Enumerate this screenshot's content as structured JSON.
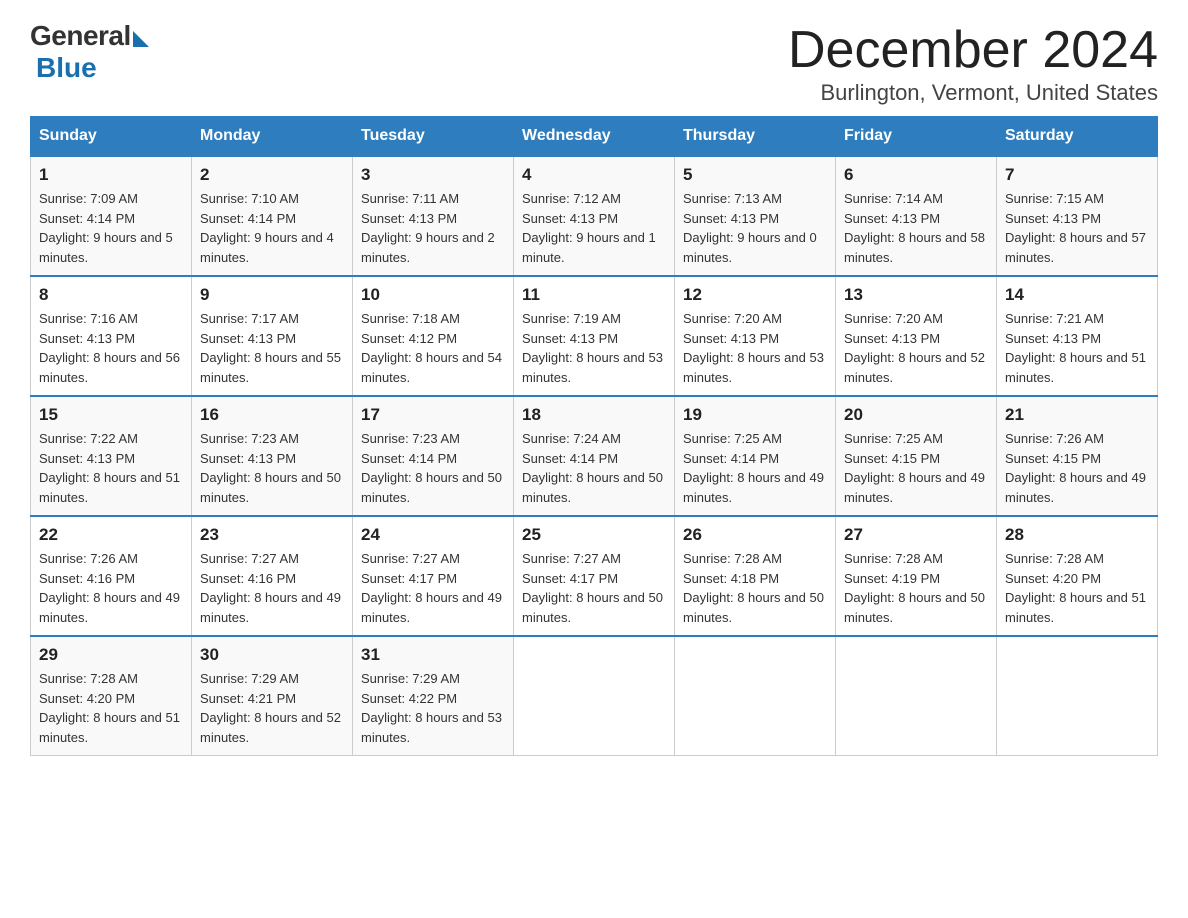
{
  "header": {
    "logo_general": "General",
    "logo_blue": "Blue",
    "title": "December 2024",
    "subtitle": "Burlington, Vermont, United States"
  },
  "days_of_week": [
    "Sunday",
    "Monday",
    "Tuesday",
    "Wednesday",
    "Thursday",
    "Friday",
    "Saturday"
  ],
  "weeks": [
    [
      {
        "day": "1",
        "sunrise": "7:09 AM",
        "sunset": "4:14 PM",
        "daylight": "9 hours and 5 minutes."
      },
      {
        "day": "2",
        "sunrise": "7:10 AM",
        "sunset": "4:14 PM",
        "daylight": "9 hours and 4 minutes."
      },
      {
        "day": "3",
        "sunrise": "7:11 AM",
        "sunset": "4:13 PM",
        "daylight": "9 hours and 2 minutes."
      },
      {
        "day": "4",
        "sunrise": "7:12 AM",
        "sunset": "4:13 PM",
        "daylight": "9 hours and 1 minute."
      },
      {
        "day": "5",
        "sunrise": "7:13 AM",
        "sunset": "4:13 PM",
        "daylight": "9 hours and 0 minutes."
      },
      {
        "day": "6",
        "sunrise": "7:14 AM",
        "sunset": "4:13 PM",
        "daylight": "8 hours and 58 minutes."
      },
      {
        "day": "7",
        "sunrise": "7:15 AM",
        "sunset": "4:13 PM",
        "daylight": "8 hours and 57 minutes."
      }
    ],
    [
      {
        "day": "8",
        "sunrise": "7:16 AM",
        "sunset": "4:13 PM",
        "daylight": "8 hours and 56 minutes."
      },
      {
        "day": "9",
        "sunrise": "7:17 AM",
        "sunset": "4:13 PM",
        "daylight": "8 hours and 55 minutes."
      },
      {
        "day": "10",
        "sunrise": "7:18 AM",
        "sunset": "4:12 PM",
        "daylight": "8 hours and 54 minutes."
      },
      {
        "day": "11",
        "sunrise": "7:19 AM",
        "sunset": "4:13 PM",
        "daylight": "8 hours and 53 minutes."
      },
      {
        "day": "12",
        "sunrise": "7:20 AM",
        "sunset": "4:13 PM",
        "daylight": "8 hours and 53 minutes."
      },
      {
        "day": "13",
        "sunrise": "7:20 AM",
        "sunset": "4:13 PM",
        "daylight": "8 hours and 52 minutes."
      },
      {
        "day": "14",
        "sunrise": "7:21 AM",
        "sunset": "4:13 PM",
        "daylight": "8 hours and 51 minutes."
      }
    ],
    [
      {
        "day": "15",
        "sunrise": "7:22 AM",
        "sunset": "4:13 PM",
        "daylight": "8 hours and 51 minutes."
      },
      {
        "day": "16",
        "sunrise": "7:23 AM",
        "sunset": "4:13 PM",
        "daylight": "8 hours and 50 minutes."
      },
      {
        "day": "17",
        "sunrise": "7:23 AM",
        "sunset": "4:14 PM",
        "daylight": "8 hours and 50 minutes."
      },
      {
        "day": "18",
        "sunrise": "7:24 AM",
        "sunset": "4:14 PM",
        "daylight": "8 hours and 50 minutes."
      },
      {
        "day": "19",
        "sunrise": "7:25 AM",
        "sunset": "4:14 PM",
        "daylight": "8 hours and 49 minutes."
      },
      {
        "day": "20",
        "sunrise": "7:25 AM",
        "sunset": "4:15 PM",
        "daylight": "8 hours and 49 minutes."
      },
      {
        "day": "21",
        "sunrise": "7:26 AM",
        "sunset": "4:15 PM",
        "daylight": "8 hours and 49 minutes."
      }
    ],
    [
      {
        "day": "22",
        "sunrise": "7:26 AM",
        "sunset": "4:16 PM",
        "daylight": "8 hours and 49 minutes."
      },
      {
        "day": "23",
        "sunrise": "7:27 AM",
        "sunset": "4:16 PM",
        "daylight": "8 hours and 49 minutes."
      },
      {
        "day": "24",
        "sunrise": "7:27 AM",
        "sunset": "4:17 PM",
        "daylight": "8 hours and 49 minutes."
      },
      {
        "day": "25",
        "sunrise": "7:27 AM",
        "sunset": "4:17 PM",
        "daylight": "8 hours and 50 minutes."
      },
      {
        "day": "26",
        "sunrise": "7:28 AM",
        "sunset": "4:18 PM",
        "daylight": "8 hours and 50 minutes."
      },
      {
        "day": "27",
        "sunrise": "7:28 AM",
        "sunset": "4:19 PM",
        "daylight": "8 hours and 50 minutes."
      },
      {
        "day": "28",
        "sunrise": "7:28 AM",
        "sunset": "4:20 PM",
        "daylight": "8 hours and 51 minutes."
      }
    ],
    [
      {
        "day": "29",
        "sunrise": "7:28 AM",
        "sunset": "4:20 PM",
        "daylight": "8 hours and 51 minutes."
      },
      {
        "day": "30",
        "sunrise": "7:29 AM",
        "sunset": "4:21 PM",
        "daylight": "8 hours and 52 minutes."
      },
      {
        "day": "31",
        "sunrise": "7:29 AM",
        "sunset": "4:22 PM",
        "daylight": "8 hours and 53 minutes."
      },
      null,
      null,
      null,
      null
    ]
  ]
}
